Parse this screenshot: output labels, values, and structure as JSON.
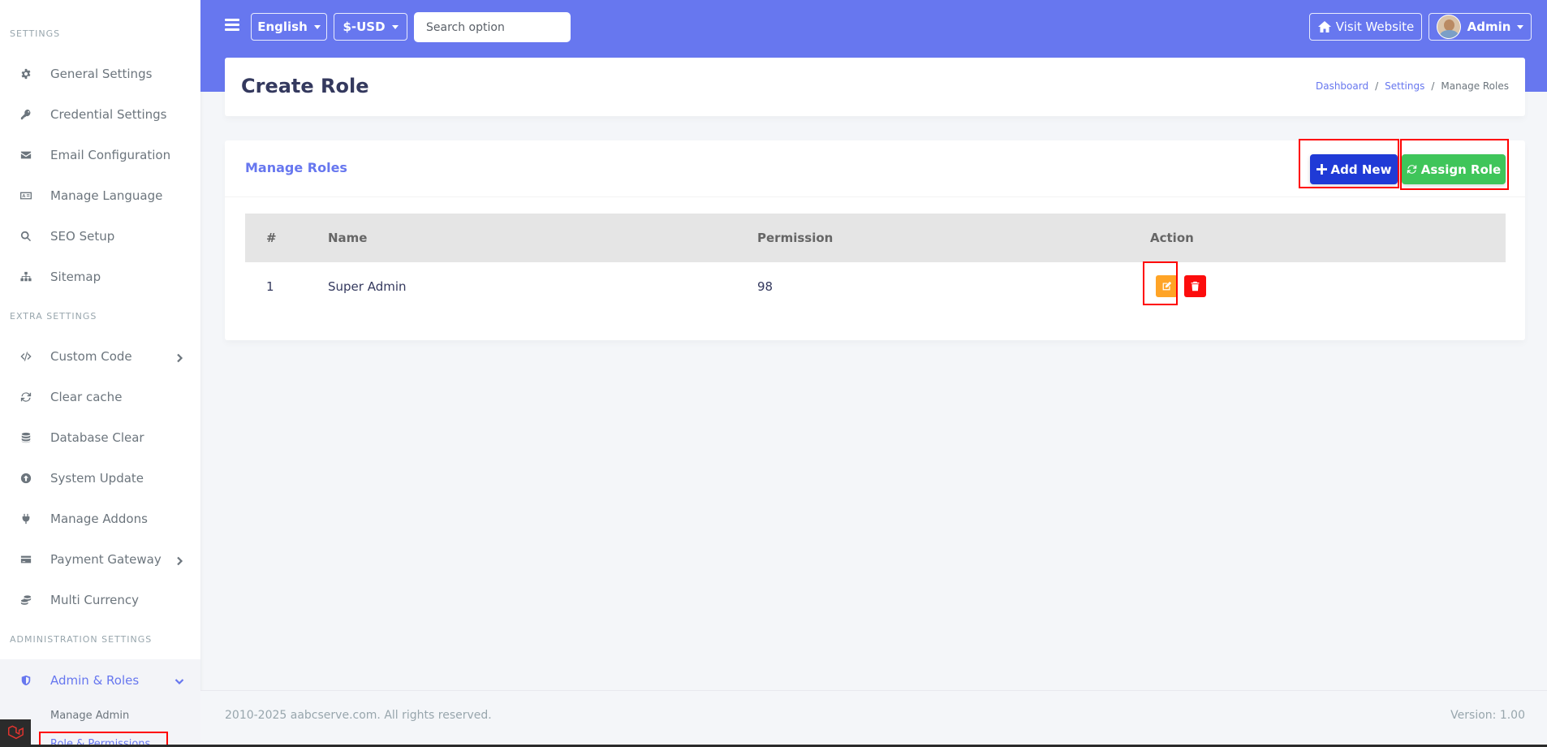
{
  "sidebar": {
    "sections": [
      {
        "header": "SETTINGS"
      },
      {
        "header": "EXTRA SETTINGS"
      },
      {
        "header": "ADMINISTRATION SETTINGS"
      }
    ],
    "items": [
      {
        "label": "General Settings",
        "icon": "gear-icon"
      },
      {
        "label": "Credential Settings",
        "icon": "key-icon"
      },
      {
        "label": "Email Configuration",
        "icon": "envelope-icon"
      },
      {
        "label": "Manage Language",
        "icon": "language-icon"
      },
      {
        "label": "SEO Setup",
        "icon": "search-icon"
      },
      {
        "label": "Sitemap",
        "icon": "sitemap-icon"
      },
      {
        "label": "Custom Code",
        "icon": "code-icon"
      },
      {
        "label": "Clear cache",
        "icon": "refresh-icon"
      },
      {
        "label": "Database Clear",
        "icon": "database-icon"
      },
      {
        "label": "System Update",
        "icon": "upload-icon"
      },
      {
        "label": "Manage Addons",
        "icon": "plug-icon"
      },
      {
        "label": "Payment Gateway",
        "icon": "credit-card-icon"
      },
      {
        "label": "Multi Currency",
        "icon": "coins-icon"
      },
      {
        "label": "Admin & Roles",
        "icon": "shield-icon"
      }
    ],
    "subitems": [
      {
        "label": "Manage Admin"
      },
      {
        "label": "Role & Permissions"
      }
    ]
  },
  "topbar": {
    "language": "English",
    "currency": "$-USD",
    "search_placeholder": "Search option",
    "visit_website": "Visit Website",
    "user": "Admin"
  },
  "page": {
    "title": "Create Role",
    "breadcrumb": [
      "Dashboard",
      "Settings",
      "Manage Roles"
    ]
  },
  "card": {
    "title": "Manage Roles",
    "add_new": "Add New",
    "assign_role": "Assign Role",
    "columns": [
      "#",
      "Name",
      "Permission",
      "Action"
    ],
    "rows": [
      {
        "num": "1",
        "name": "Super Admin",
        "permission": "98"
      }
    ]
  },
  "footer": {
    "copyright": "2010-2025 aabcserve.com. All rights reserved.",
    "version": "Version: 1.00"
  },
  "colors": {
    "primary": "#6777ef",
    "add_button": "#1f3ad6",
    "assign_button": "#3fc55a",
    "edit_button": "#ffa426",
    "delete_button": "#fc0d0d",
    "highlight": "#ff0000"
  }
}
